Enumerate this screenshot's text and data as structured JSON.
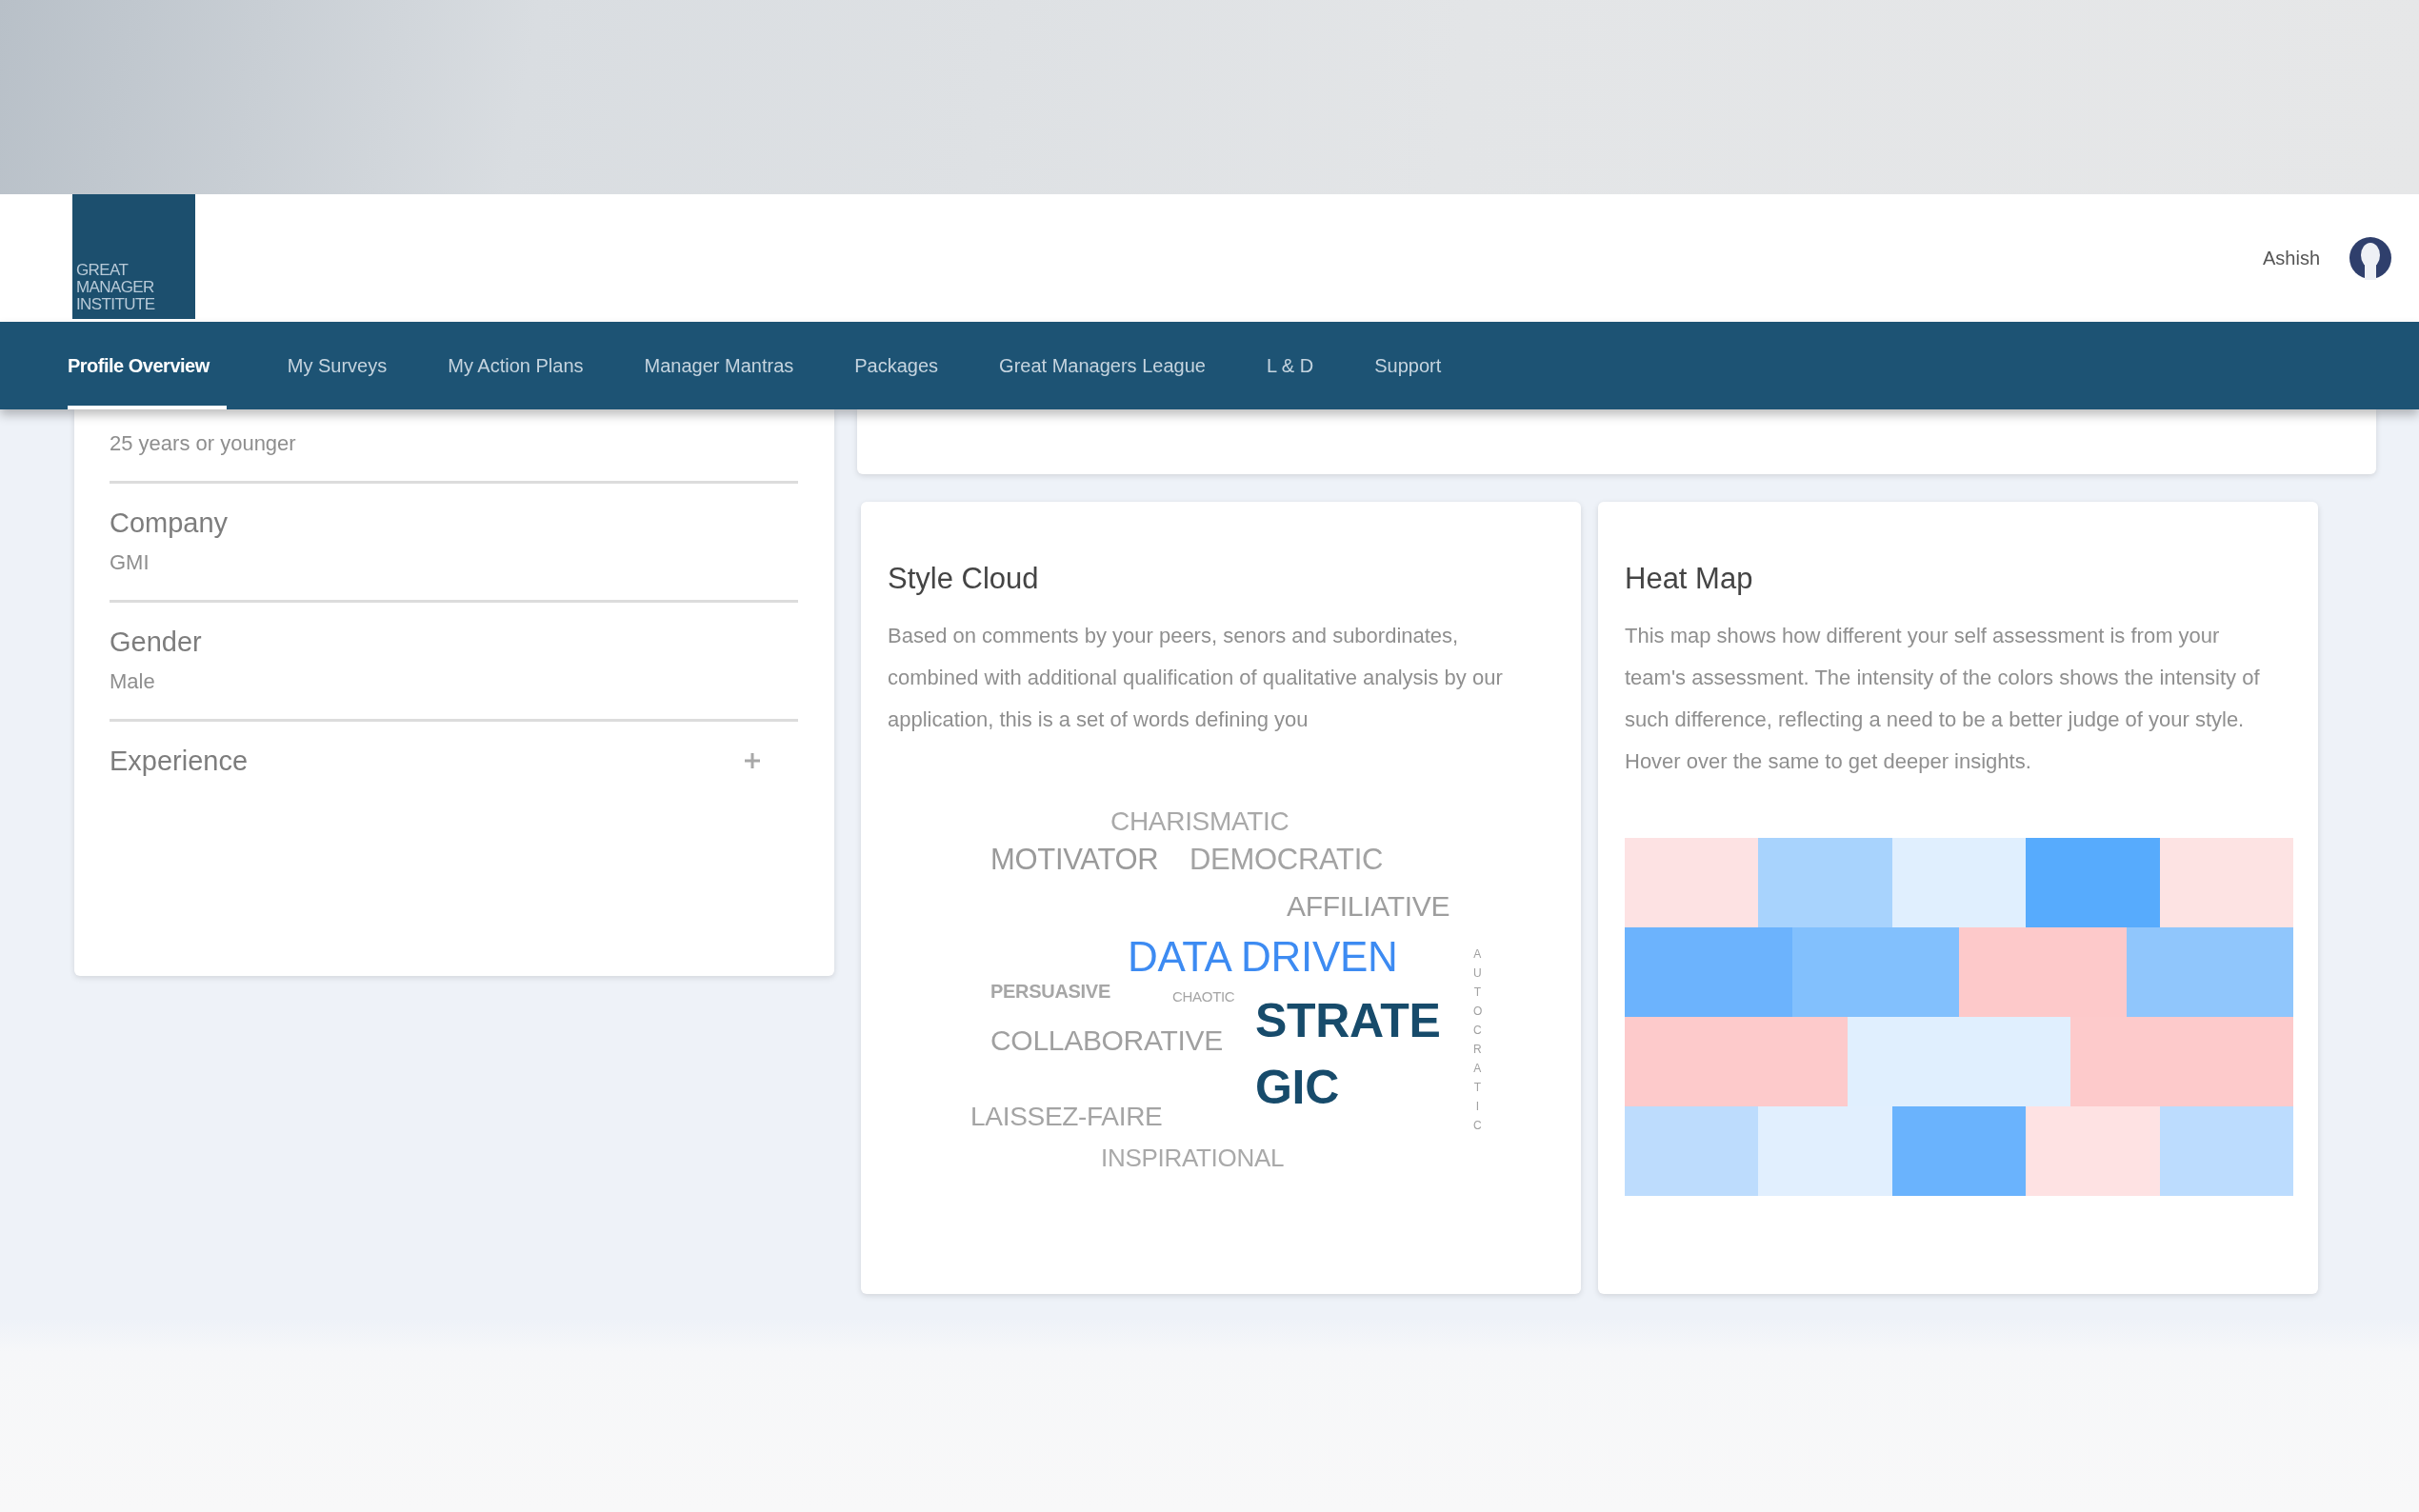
{
  "logo": {
    "lines": [
      "GREAT",
      "MANAGER",
      "INSTITUTE"
    ]
  },
  "user": {
    "name": "Ashish"
  },
  "nav": [
    {
      "label": "Profile Overview",
      "selected": true
    },
    {
      "label": "My Surveys",
      "selected": false
    },
    {
      "label": "My Action Plans",
      "selected": false
    },
    {
      "label": "Manager Mantras",
      "selected": false
    },
    {
      "label": "Packages",
      "selected": false
    },
    {
      "label": "Great Managers League",
      "selected": false
    },
    {
      "label": "L & D",
      "selected": false
    },
    {
      "label": "Support",
      "selected": false
    }
  ],
  "profile": {
    "fields": [
      {
        "value": "25 years or younger"
      },
      {
        "label": "Company",
        "value": "GMI"
      },
      {
        "label": "Gender",
        "value": "Male"
      },
      {
        "label": "Experience",
        "expanded": false
      }
    ]
  },
  "style_cloud": {
    "title": "Style Cloud",
    "description": "Based on comments by your peers, senors and subordinates, combined with additional qualification of qualitative analysis by our application, this is a set of words defining you",
    "words": [
      {
        "text": "CHARISMATIC",
        "color": "#a9a9a9"
      },
      {
        "text": "MOTIVATOR",
        "color": "#9a9a9a"
      },
      {
        "text": "DEMOCRATIC",
        "color": "#a3a3a3"
      },
      {
        "text": "AFFILIATIVE",
        "color": "#9e9e9e"
      },
      {
        "text": "DATA DRIVEN",
        "color": "#3d8bf2"
      },
      {
        "text": "PERSUASIVE",
        "color": "#a6a6a6"
      },
      {
        "text": "CHAOTIC",
        "color": "#a5a5a5"
      },
      {
        "text": "STRATE",
        "color": "#174b6b"
      },
      {
        "text": "GIC",
        "color": "#174b6b"
      },
      {
        "text": "COLLABORATIVE",
        "color": "#a0a0a0"
      },
      {
        "text": "LAISSEZ-FAIRE",
        "color": "#a4a4a4"
      },
      {
        "text": "INSPIRATIONAL",
        "color": "#a9a9a9"
      },
      {
        "text": "AUTOCRATIC",
        "color": "#a0a0a0"
      }
    ]
  },
  "heat_map": {
    "title": "Heat Map",
    "description": "This map shows how different your self assessment is from your team's assessment. The intensity of the colors shows the intensity of such difference, reflecting a need to be a better judge of your style. Hover over the same to get deeper insights.",
    "rows": [
      {
        "cells": [
          {
            "color": "#fde2e3"
          },
          {
            "color": "#a8d3fd"
          },
          {
            "color": "#e0effe"
          },
          {
            "color": "#57abfd"
          },
          {
            "color": "#fde3e3"
          }
        ]
      },
      {
        "cells": [
          {
            "color": "#6cb3fd"
          },
          {
            "color": "#82c0fd"
          },
          {
            "color": "#fdc9ca"
          },
          {
            "color": "#90c6fc"
          }
        ]
      },
      {
        "cells": [
          {
            "color": "#fdcacb"
          },
          {
            "color": "#e0effe"
          },
          {
            "color": "#fdcacb"
          }
        ]
      },
      {
        "cells": [
          {
            "color": "#bddcfd"
          },
          {
            "color": "#e1effe"
          },
          {
            "color": "#6ab3fd"
          },
          {
            "color": "#fee2e3"
          },
          {
            "color": "#bcdcfe"
          }
        ]
      }
    ]
  }
}
